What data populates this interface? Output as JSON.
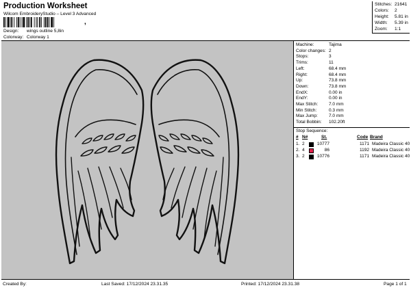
{
  "header": {
    "title": "Production Worksheet",
    "subtitle": "Wilcom EmbroideryStudio – Level 3 Advanced",
    "barcode_tail": ","
  },
  "design": {
    "label": "Design:",
    "value": "wings outline 5,8in"
  },
  "colorway": {
    "label": "Colorway:",
    "value": "Colorway 1"
  },
  "stats": [
    {
      "label": "Stitches:",
      "value": "21641"
    },
    {
      "label": "Colors:",
      "value": "2"
    },
    {
      "label": "Height:",
      "value": "5.81 in"
    },
    {
      "label": "Width:",
      "value": "5.39 in"
    },
    {
      "label": "Zoom:",
      "value": "1:1"
    }
  ],
  "machine_info": [
    {
      "label": "Machine:",
      "value": "Tajima"
    },
    {
      "label": "Color changes:",
      "value": "2"
    },
    {
      "label": "Stops:",
      "value": "3"
    },
    {
      "label": "Trims:",
      "value": "11"
    },
    {
      "label": "Left:",
      "value": "68.4 mm"
    },
    {
      "label": "Right:",
      "value": "68.4 mm"
    },
    {
      "label": "Up:",
      "value": "73.8 mm"
    },
    {
      "label": "Down:",
      "value": "73.8 mm"
    },
    {
      "label": "EndX:",
      "value": "0.00 in"
    },
    {
      "label": "EndY:",
      "value": "0.00 in"
    },
    {
      "label": "Max Stitch:",
      "value": "7.0 mm"
    },
    {
      "label": "Min Stitch:",
      "value": "0.3 mm"
    },
    {
      "label": "Max Jump:",
      "value": "7.0 mm"
    },
    {
      "label": "Total Bobbin:",
      "value": "102.20ft"
    }
  ],
  "stop_sequence": {
    "title": "Stop Sequence:",
    "headers": {
      "num": "#",
      "n": "N#",
      "st": "St.",
      "code": "Code",
      "brand": "Brand"
    },
    "rows": [
      {
        "num": "1.",
        "n": "2",
        "color": "#000000",
        "st": "10777",
        "code": "1171",
        "brand": "Madeira Classic 40"
      },
      {
        "num": "2.",
        "n": "4",
        "color": "#e0204a",
        "st": "86",
        "code": "1192",
        "brand": "Madeira Classic 40"
      },
      {
        "num": "3.",
        "n": "2",
        "color": "#000000",
        "st": "10776",
        "code": "1171",
        "brand": "Madeira Classic 40"
      }
    ]
  },
  "footer": {
    "created": "Created By:",
    "last_saved": "Last Saved: 17/12/2024 23.31.35",
    "printed": "Printed: 17/12/2024 23.31.38",
    "page": "Page 1 of 1"
  },
  "colors": {
    "canvas_bg": "#c3c3c3",
    "stitch": "#111111"
  }
}
